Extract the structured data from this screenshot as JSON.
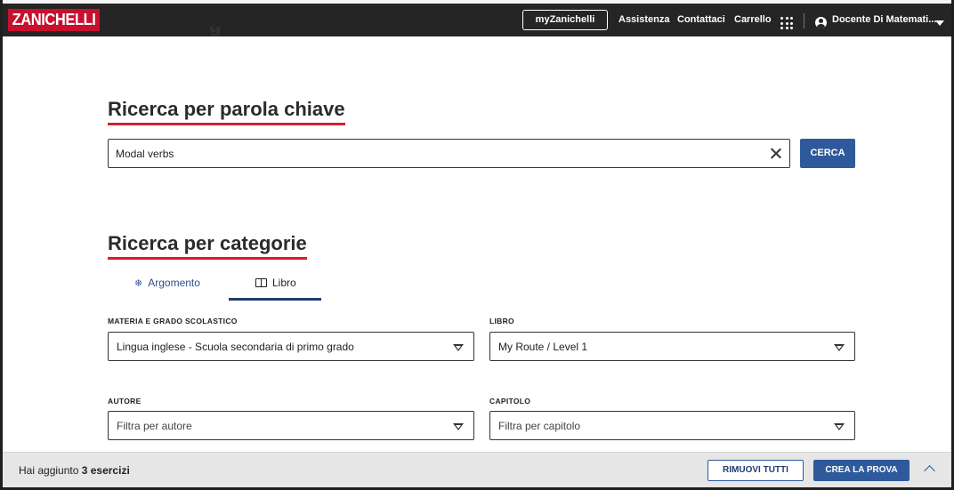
{
  "header": {
    "logo": "ZANICHELLI",
    "my_button": "myZanichelli",
    "links": [
      "Assistenza",
      "Contattaci",
      "Carrello"
    ],
    "user": "Docente Di Matemati...",
    "page_title_fragment": "g"
  },
  "keyword_search": {
    "title": "Ricerca per parola chiave",
    "value": "Modal verbs",
    "button": "CERCA"
  },
  "category_search": {
    "title": "Ricerca per categorie",
    "tabs": [
      {
        "label": "Argomento",
        "icon": "snowflake-icon",
        "active": false
      },
      {
        "label": "Libro",
        "icon": "book-icon",
        "active": true
      }
    ],
    "fields": {
      "materia": {
        "label": "MATERIA E GRADO SCOLASTICO",
        "value": "Lingua inglese - Scuola secondaria di primo grado"
      },
      "libro": {
        "label": "LIBRO",
        "value": "My Route / Level 1"
      },
      "autore": {
        "label": "AUTORE",
        "placeholder": "Filtra per autore"
      },
      "capitolo": {
        "label": "CAPITOLO",
        "placeholder": "Filtra per capitolo"
      }
    }
  },
  "footer": {
    "added_prefix": "Hai aggiunto",
    "added_count": "3 esercizi",
    "remove_all": "RIMUOVI TUTTI",
    "create": "CREA LA PROVA"
  },
  "colors": {
    "brand": "#c8102e",
    "primary": "#2e5a9c",
    "header_bg": "#252525",
    "title_underline": "#d81e2c"
  }
}
